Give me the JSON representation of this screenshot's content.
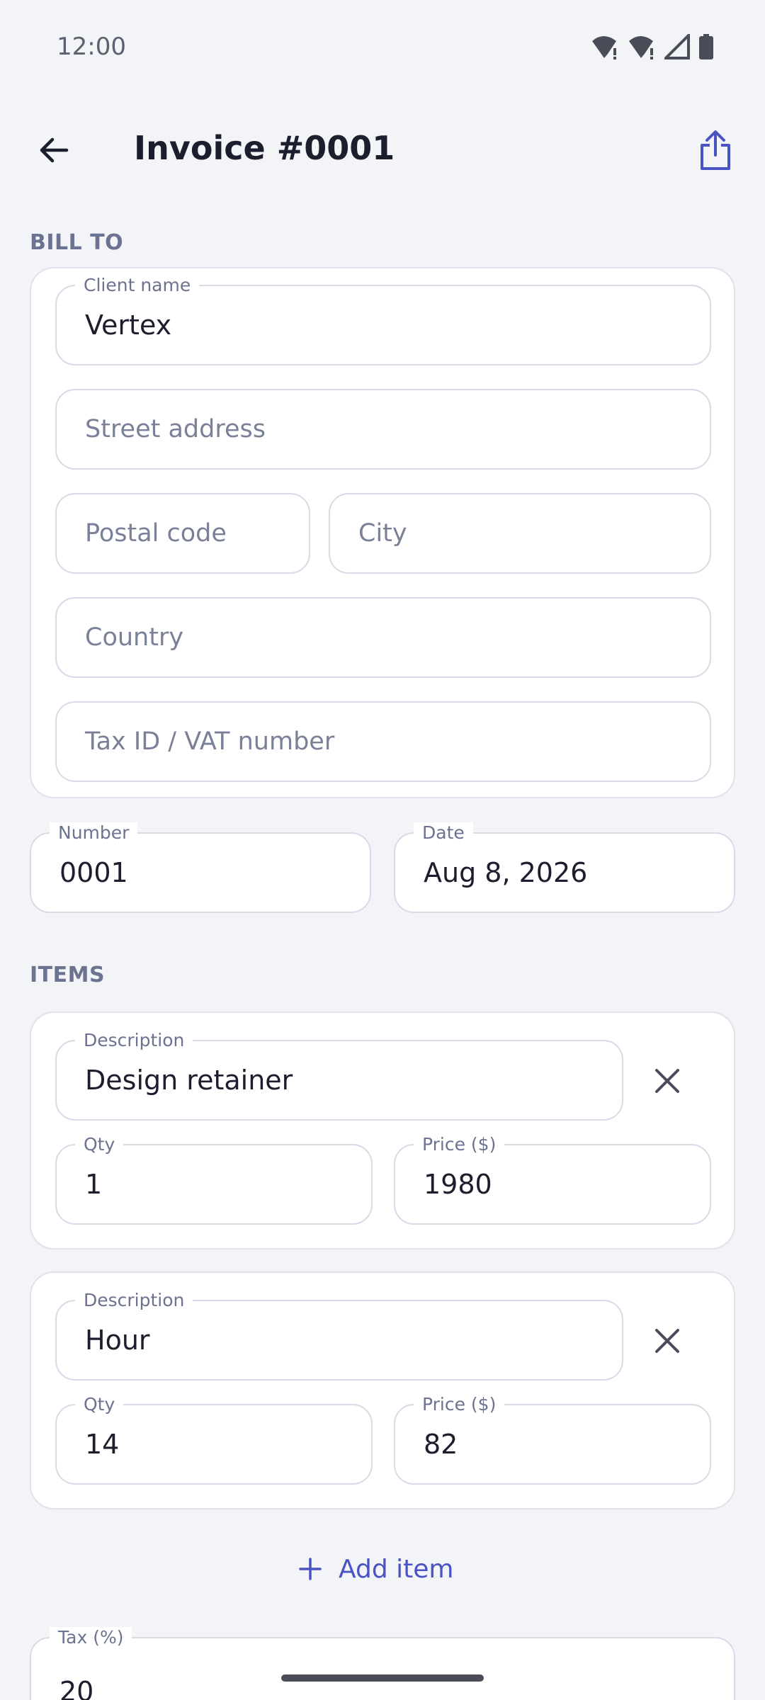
{
  "status_bar": {
    "time": "12:00"
  },
  "app_bar": {
    "title": "Invoice #0001"
  },
  "bill_to": {
    "section_label": "BILL TO",
    "client_name": {
      "label": "Client name",
      "value": "Vertex"
    },
    "street_address": {
      "placeholder": "Street address"
    },
    "postal_code": {
      "placeholder": "Postal code"
    },
    "city": {
      "placeholder": "City"
    },
    "country": {
      "placeholder": "Country"
    },
    "tax_id": {
      "placeholder": "Tax ID / VAT number"
    }
  },
  "invoice_meta": {
    "number": {
      "label": "Number",
      "value": "0001"
    },
    "date": {
      "label": "Date",
      "value": "Aug 8, 2026"
    }
  },
  "items": {
    "section_label": "ITEMS",
    "list": [
      {
        "description_label": "Description",
        "description": "Design retainer",
        "qty_label": "Qty",
        "qty": "1",
        "price_label": "Price ($)",
        "price": "1980"
      },
      {
        "description_label": "Description",
        "description": "Hour",
        "qty_label": "Qty",
        "qty": "14",
        "price_label": "Price ($)",
        "price": "82"
      }
    ],
    "add_label": "Add item"
  },
  "tax": {
    "label": "Tax (%)",
    "value": "20"
  },
  "colors": {
    "accent": "#4a53c4",
    "background": "#f3f4f8",
    "border": "#d8dae8",
    "muted": "#6b7391"
  }
}
